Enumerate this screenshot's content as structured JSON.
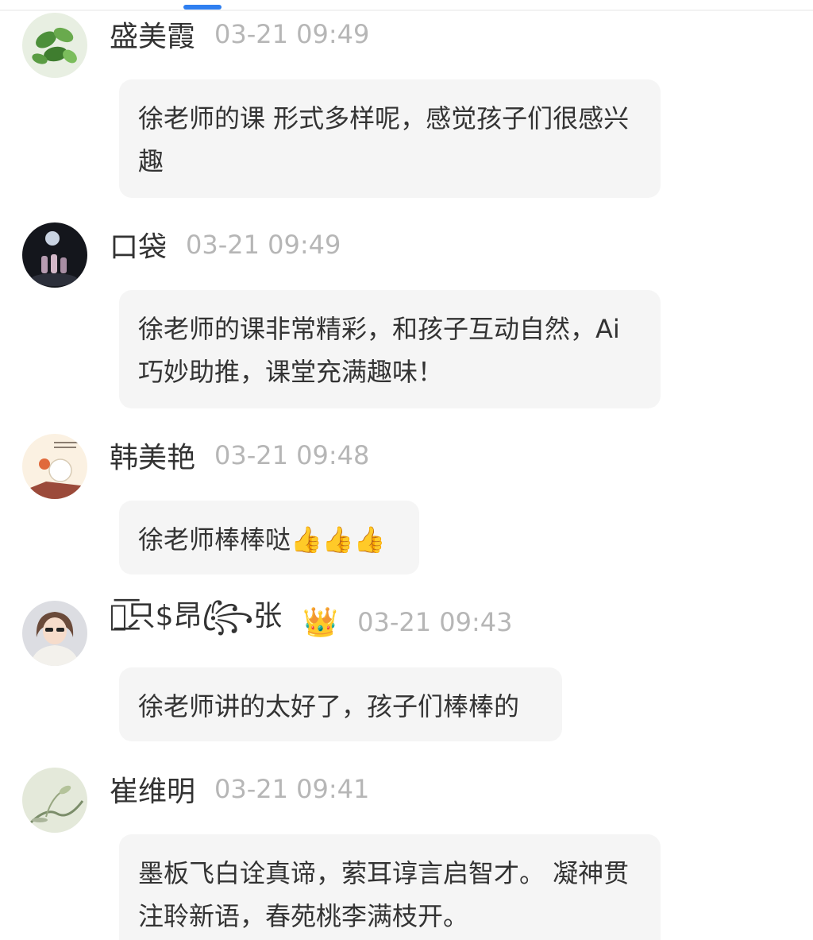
{
  "comments": [
    {
      "name": "盛美霞",
      "time": "03-21 09:49",
      "text": "徐老师的课 形式多样呢，感觉孩子们很感兴趣",
      "avatar_icon": "plant-leaves-avatar"
    },
    {
      "name": "口袋",
      "time": "03-21 09:49",
      "text": "徐老师的课非常精彩，和孩子互动自然，Ai巧妙助推，课堂充满趣味！",
      "avatar_icon": "night-scene-avatar"
    },
    {
      "name": "韩美艳",
      "time": "03-21 09:48",
      "text": "徐老师棒棒哒👍👍👍",
      "avatar_icon": "cartoon-avatar"
    },
    {
      "name": "ꦿ͟͟͞只$昂꧂ꦿ张",
      "time": "03-21 09:43",
      "text": "徐老师讲的太好了，孩子们棒棒的",
      "avatar_icon": "girl-avatar",
      "badge": "👑"
    },
    {
      "name": "崔维明",
      "time": "03-21 09:41",
      "text": "墨板飞白诠真谛，萦耳谆言启智才。 凝神贯注聆新语，春苑桃李满枝开。",
      "avatar_icon": "ink-painting-avatar"
    }
  ]
}
